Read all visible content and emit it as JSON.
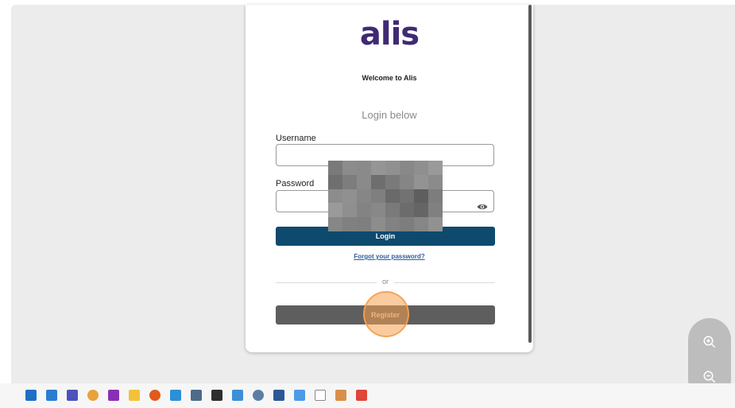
{
  "login": {
    "logo_text": "alis",
    "welcome_text": "Welcome to Alis",
    "subtitle": "Login below",
    "username_label": "Username",
    "username_value": "",
    "password_label": "Password",
    "password_value": "",
    "login_button": "Login",
    "forgot_link": "Forgot your password?",
    "or_text": "or",
    "register_button": "Register"
  },
  "zoom": {
    "zoom_in_icon": "zoom-in-icon",
    "zoom_out_icon": "zoom-out-icon"
  },
  "colors": {
    "logo": "#3f2a73",
    "login_button": "#0d4a6e",
    "register_button": "#5e5e5e",
    "click_highlight": "#f5a050"
  },
  "taskbar": {
    "icons": [
      "outlook-icon",
      "mail-icon",
      "teams-icon",
      "chrome-icon",
      "onenote-icon",
      "file-explorer-icon",
      "search-tool-icon",
      "app-icon",
      "calculator-icon",
      "sticky-notes-icon",
      "network-icon",
      "settings-icon",
      "word-icon",
      "calendar-icon",
      "notepad-icon",
      "shield-icon",
      "pdf-icon"
    ]
  }
}
